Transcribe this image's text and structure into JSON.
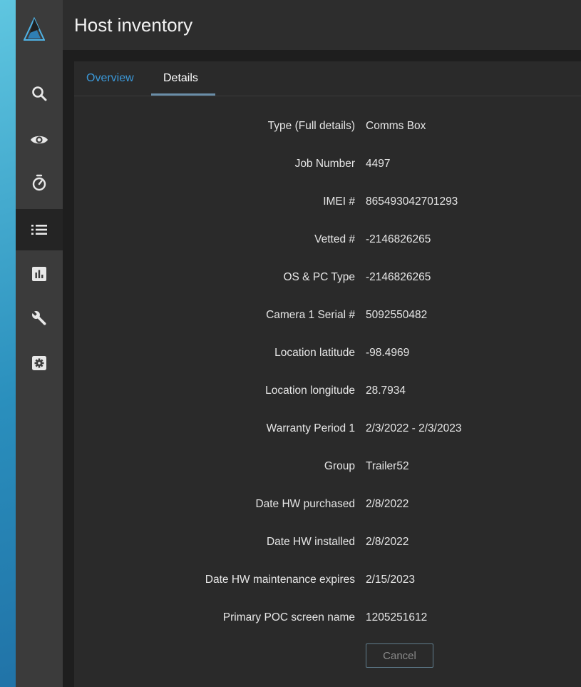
{
  "app": {
    "title": "Host inventory"
  },
  "sidebar": {
    "items": [
      {
        "icon": "search-icon",
        "active": false
      },
      {
        "icon": "eye-icon",
        "active": false
      },
      {
        "icon": "stopwatch-icon",
        "active": false
      },
      {
        "icon": "list-icon",
        "active": true
      },
      {
        "icon": "bar-chart-icon",
        "active": false
      },
      {
        "icon": "wrench-icon",
        "active": false
      },
      {
        "icon": "gear-icon",
        "active": false
      }
    ]
  },
  "tabs": [
    {
      "label": "Overview",
      "active": false
    },
    {
      "label": "Details",
      "active": true
    }
  ],
  "details": [
    {
      "label": "Type (Full details)",
      "value": "Comms Box"
    },
    {
      "label": "Job Number",
      "value": "4497"
    },
    {
      "label": "IMEI #",
      "value": "865493042701293"
    },
    {
      "label": "Vetted #",
      "value": "-2146826265"
    },
    {
      "label": "OS & PC Type",
      "value": "-2146826265"
    },
    {
      "label": "Camera 1 Serial #",
      "value": "5092550482"
    },
    {
      "label": "Location latitude",
      "value": "-98.4969"
    },
    {
      "label": "Location longitude",
      "value": "28.7934"
    },
    {
      "label": "Warranty Period 1",
      "value": "2/3/2022 - 2/3/2023"
    },
    {
      "label": "Group",
      "value": "Trailer52"
    },
    {
      "label": "Date HW purchased",
      "value": "2/8/2022"
    },
    {
      "label": "Date HW installed",
      "value": "2/8/2022"
    },
    {
      "label": "Date HW maintenance expires",
      "value": "2/15/2023"
    },
    {
      "label": "Primary POC screen name",
      "value": "1205251612"
    }
  ],
  "actions": {
    "cancel_label": "Cancel"
  },
  "colors": {
    "accent": "#3b98d8",
    "sidebar_bg": "#3b3b3b",
    "panel_bg": "#2a2a2a",
    "text": "#e6e6e6"
  }
}
